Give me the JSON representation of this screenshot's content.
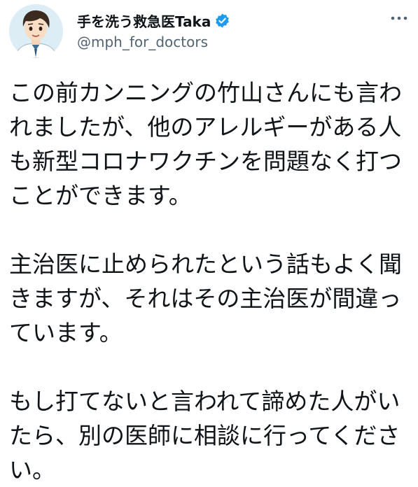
{
  "author": {
    "display_name": "手を洗う救急医Taka",
    "handle": "@mph_for_doctors",
    "verified": true
  },
  "menu_icon": "more-horizontal-icon",
  "colors": {
    "verified_badge": "#1d9bf0",
    "text_primary": "#0f1419",
    "text_secondary": "#536471"
  },
  "tweet": {
    "paragraphs": [
      "この前カンニングの竹山さんにも言われましたが、他のアレルギーがある人も新型コロナワクチンを問題なく打つことができます。",
      "主治医に止められたという話もよく聞きますが、それはその主治医が間違っています。",
      "もし打てないと言われて諦めた人がいたら、別の医師に相談に行ってください。"
    ]
  }
}
